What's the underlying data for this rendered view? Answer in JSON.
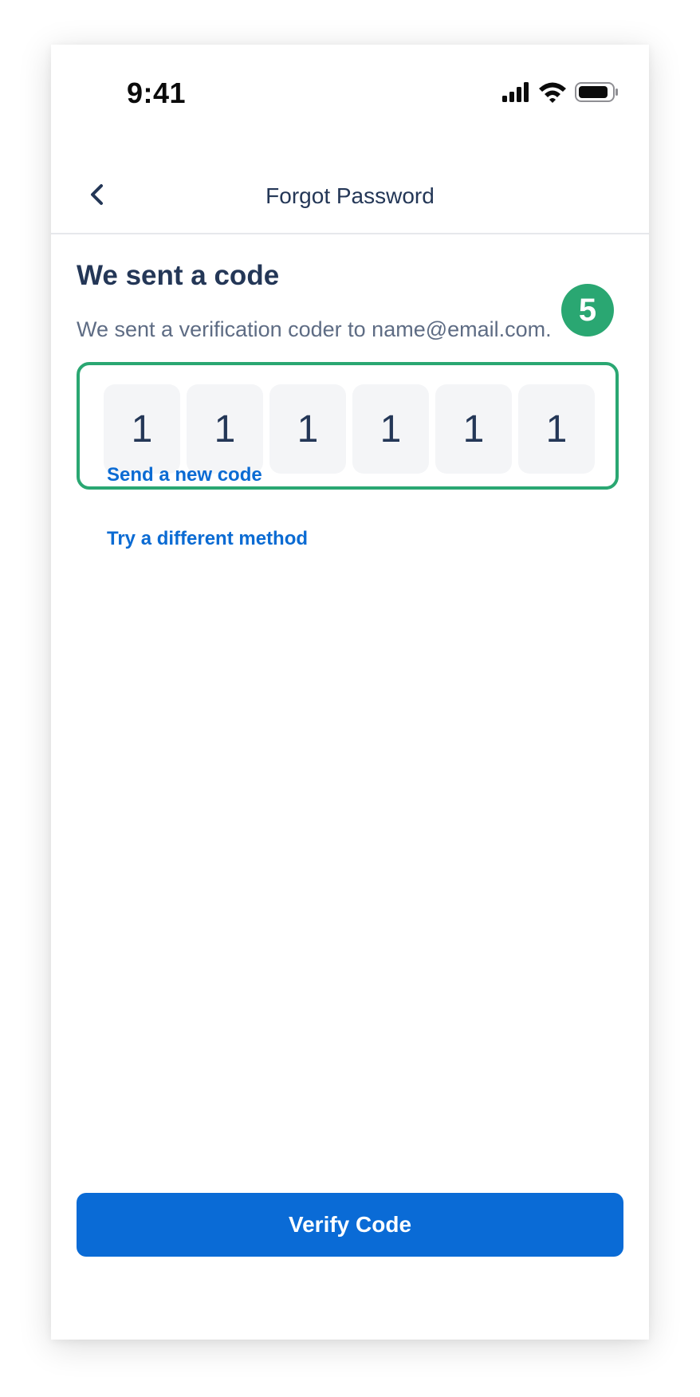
{
  "status_bar": {
    "time": "9:41",
    "icons": [
      "signal-icon",
      "wifi-icon",
      "battery-icon"
    ]
  },
  "nav": {
    "title": "Forgot Password",
    "back_icon": "chevron-left-icon"
  },
  "content": {
    "heading": "We sent a code",
    "subtext": "We sent a verification coder to name@email.com.",
    "code_digits": [
      "1",
      "1",
      "1",
      "1",
      "1",
      "1"
    ],
    "step_badge": "5",
    "links": {
      "resend": "Send a new code",
      "different_method": "Try a different method"
    }
  },
  "actions": {
    "verify": "Verify Code"
  },
  "colors": {
    "primary": "#0a6bd6",
    "heading": "#243757",
    "highlight": "#2aa772",
    "cell_bg": "#f4f5f7",
    "subtext": "#5e6c84"
  }
}
